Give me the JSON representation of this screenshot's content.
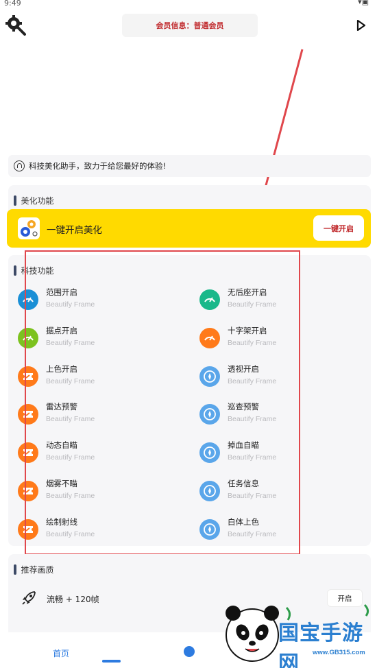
{
  "status_bar": {
    "time": "9:49"
  },
  "header": {
    "member_info": "会员信息：普通会员"
  },
  "notice": {
    "text": "科技美化助手，致力于给您最好的体验!"
  },
  "beautify": {
    "section_title": "美化功能",
    "one_key_label": "一键开启美化",
    "one_key_button": "一键开启"
  },
  "tech": {
    "section_title": "科技功能",
    "left": [
      {
        "name": "范围开启",
        "sub": "Beautify Frame",
        "icon": "gauge-icon",
        "color": "#1a8fd6"
      },
      {
        "name": "据点开启",
        "sub": "Beautify Frame",
        "icon": "gauge-icon",
        "color": "#7cc21f"
      },
      {
        "name": "上色开启",
        "sub": "Beautify Frame",
        "icon": "ticket-icon",
        "color": "#ff7a1a"
      },
      {
        "name": "雷达预警",
        "sub": "Beautify Frame",
        "icon": "ticket-icon",
        "color": "#ff7a1a"
      },
      {
        "name": "动态自瞄",
        "sub": "Beautify Frame",
        "icon": "ticket-icon",
        "color": "#ff7a1a"
      },
      {
        "name": "烟雾不瞄",
        "sub": "Beautify Frame",
        "icon": "ticket-icon",
        "color": "#ff7a1a"
      },
      {
        "name": "绘制射线",
        "sub": "Beautify Frame",
        "icon": "ticket-icon",
        "color": "#ff7a1a"
      }
    ],
    "right": [
      {
        "name": "无后座开启",
        "sub": "Beautify Frame",
        "icon": "gauge-icon",
        "color": "#19b88a"
      },
      {
        "name": "十字架开启",
        "sub": "Beautify Frame",
        "icon": "gauge-icon",
        "color": "#ff7a1a"
      },
      {
        "name": "透视开启",
        "sub": "Beautify Frame",
        "icon": "compass-icon",
        "color": "#5aa6ea"
      },
      {
        "name": "巡查预警",
        "sub": "Beautify Frame",
        "icon": "compass-icon",
        "color": "#5aa6ea"
      },
      {
        "name": "掉血自瞄",
        "sub": "Beautify Frame",
        "icon": "compass-icon",
        "color": "#5aa6ea"
      },
      {
        "name": "任务信息",
        "sub": "Beautify Frame",
        "icon": "compass-icon",
        "color": "#5aa6ea"
      },
      {
        "name": "白体上色",
        "sub": "Beautify Frame",
        "icon": "compass-icon",
        "color": "#5aa6ea"
      }
    ]
  },
  "recommend": {
    "section_title": "推荐画质",
    "items": [
      {
        "label": "流畅 + 120帧",
        "button": "开启",
        "icon": "rocket-icon"
      }
    ]
  },
  "bottom_nav": {
    "home": "首页"
  },
  "watermark": {
    "brand": "国宝手游网",
    "url": "www.GB315.com"
  },
  "colors": {
    "accent_yellow": "#ffda00",
    "red": "#c0282b",
    "blue": "#2d7be0",
    "annotation_red": "#e0474c"
  }
}
